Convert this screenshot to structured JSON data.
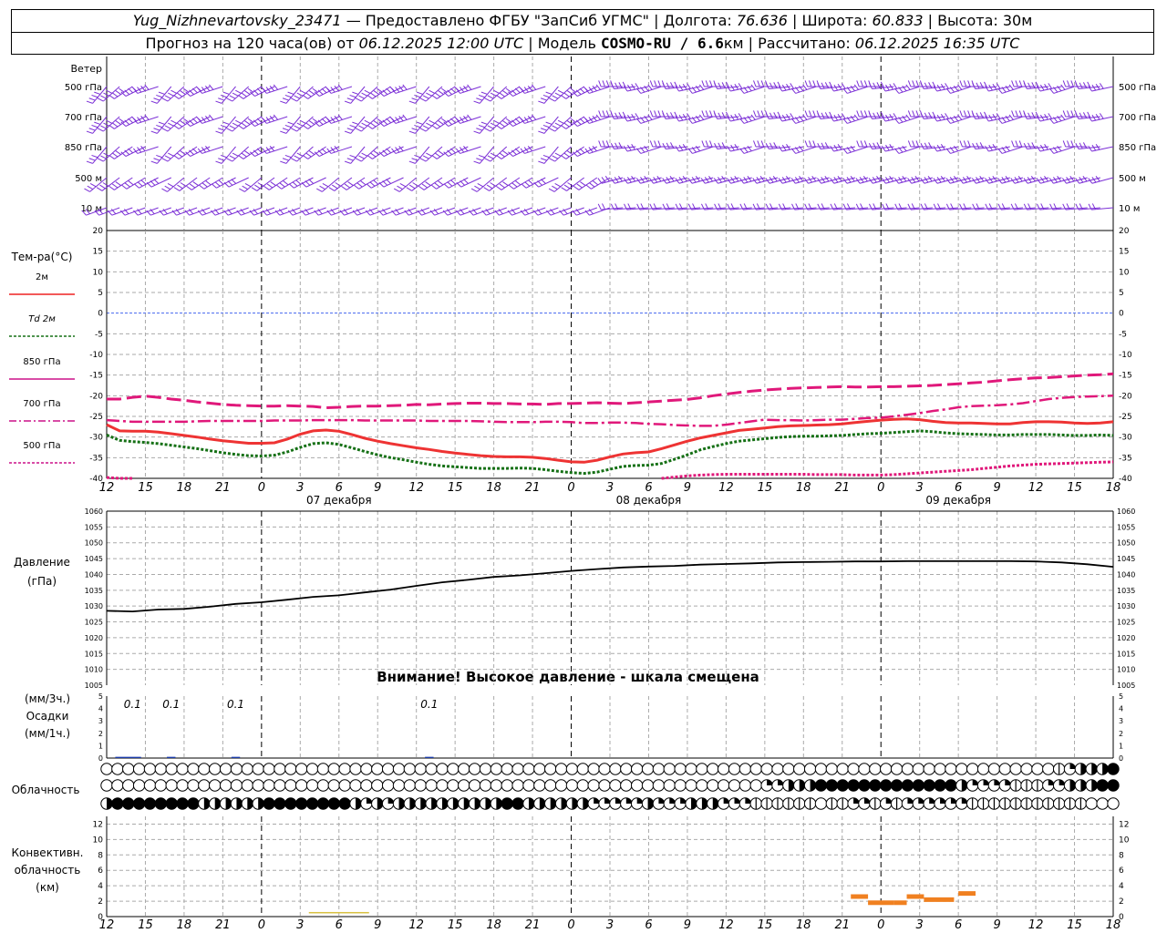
{
  "header": {
    "station": "Yug_Nizhnevartovsky_23471",
    "provider": "— Предоставлено ФГБУ \"ЗапСиб УГМС\" | Долгота:",
    "lon": "76.636",
    "lat_label": "| Широта:",
    "lat": "60.833",
    "alt_label": "| Высота: 30м",
    "forecast_label": "Прогноз на 120 часа(ов) от",
    "forecast_time": "06.12.2025 12:00 UTC",
    "model_label": "| Модель",
    "model": "COSMO-RU / 6.6",
    "model_unit": "км | Рассчитано:",
    "computed_time": "06.12.2025 16:35 UTC"
  },
  "wind_panel": {
    "title": "Ветер",
    "levels": [
      "500 гПа",
      "700 гПа",
      "850 гПа",
      "500 м",
      "10 м"
    ]
  },
  "temp_panel": {
    "title": "Тем-ра(°С)",
    "ylim": [
      -40,
      20
    ],
    "yticks": [
      20,
      15,
      10,
      5,
      0,
      -5,
      -10,
      -15,
      -20,
      -25,
      -30,
      -35,
      -40
    ],
    "legend": [
      {
        "label": "2м",
        "color": "#ee2222",
        "dash": ""
      },
      {
        "label": "Td 2м",
        "color": "#157015",
        "dash": "3,2"
      },
      {
        "label": "850 гПа",
        "color": "#cc1188",
        "dash": ""
      },
      {
        "label": "700 гПа",
        "color": "#cc1188",
        "dash": "8,3,2,3"
      },
      {
        "label": "500 гПа",
        "color": "#cc1188",
        "dash": "3,2"
      }
    ]
  },
  "x_axis": {
    "ticks": [
      "12",
      "15",
      "18",
      "21",
      "0",
      "3",
      "6",
      "9",
      "12",
      "15",
      "18",
      "21",
      "0",
      "3",
      "6",
      "9",
      "12",
      "15",
      "18",
      "21",
      "0",
      "3",
      "6",
      "9",
      "12",
      "15",
      "18"
    ],
    "dates": [
      "07 декабря",
      "08 декабря",
      "09 декабря"
    ]
  },
  "pressure_panel": {
    "title": "Давление",
    "unit": "(гПа)",
    "ylim": [
      1005,
      1060
    ],
    "yticks": [
      1060,
      1055,
      1050,
      1045,
      1040,
      1035,
      1030,
      1025,
      1020,
      1015,
      1010,
      1005
    ],
    "warning": "Внимание! Высокое давление - шкала смещена"
  },
  "precip_panel": {
    "unit_top": "(мм/3ч.)",
    "title": "Осадки",
    "unit_bottom": "(мм/1ч.)",
    "yticks": [
      5,
      4,
      3,
      2,
      1,
      0
    ],
    "labels": [
      {
        "hour": 6,
        "text": "0.1"
      },
      {
        "hour": 15,
        "text": "0.1"
      },
      {
        "hour": 30,
        "text": "0.1"
      },
      {
        "hour": 75,
        "text": "0.1"
      }
    ]
  },
  "cloud_panel": {
    "title": "Облачность"
  },
  "convective_panel": {
    "title_lines": [
      "Конвективн.",
      "облачность",
      "(км)"
    ],
    "yticks": [
      12,
      10,
      8,
      6,
      4,
      2,
      0
    ]
  },
  "colors": {
    "wind": "#7b2fd6",
    "grid": "#aaaaaa",
    "zero_line": "#4466ee",
    "pressure": "#000000",
    "precip": "#1a3aa8",
    "convective_orange": "#f08020",
    "convective_yellow": "#d8c040"
  },
  "chart_data": [
    {
      "type": "line",
      "title": "Тем-ра(°С)",
      "x_hours": [
        0,
        3,
        6,
        9,
        12,
        15,
        18,
        21,
        24,
        27,
        30,
        33,
        36,
        39,
        42,
        45,
        48,
        51,
        54,
        57,
        60,
        63,
        66,
        69,
        72,
        75,
        78,
        81,
        84,
        87,
        90,
        93,
        96,
        99,
        102,
        105,
        108,
        111,
        114,
        117,
        120,
        123,
        126,
        129,
        132,
        135,
        138,
        141,
        144,
        147,
        150,
        153,
        156,
        159,
        162,
        165,
        168,
        171,
        174,
        177,
        180,
        183,
        186,
        189,
        192,
        195,
        198,
        201,
        204,
        207,
        210,
        213,
        216,
        219,
        222,
        225,
        228,
        231,
        234
      ],
      "series": [
        {
          "name": "2м",
          "values": [
            -27,
            -28.5,
            -28.6,
            -28.6,
            -28.8,
            -29.2,
            -29.6,
            -30,
            -30.5,
            -30.9,
            -31.2,
            -31.5,
            -31.5,
            -31.4,
            -30.5,
            -29.3,
            -28.5,
            -28.3,
            -28.6,
            -29.4,
            -30.3,
            -31,
            -31.6,
            -32.1,
            -32.6,
            -33,
            -33.5,
            -33.9,
            -34.2,
            -34.5,
            -34.7,
            -34.8,
            -34.8,
            -34.9,
            -35.2,
            -35.6,
            -36,
            -36.1,
            -35.6,
            -34.8,
            -34.1,
            -33.8,
            -33.6,
            -32.8,
            -31.9,
            -31,
            -30.2,
            -29.6,
            -29,
            -28.4,
            -28.1,
            -27.8,
            -27.5,
            -27.3,
            -27.2,
            -27.1,
            -27,
            -26.8,
            -26.5,
            -26.2,
            -25.9,
            -25.7,
            -25.6,
            -25.8,
            -26.2,
            -26.5,
            -26.6,
            -26.6,
            -26.7,
            -26.8,
            -26.8,
            -26.5,
            -26.3,
            -26.3,
            -26.4,
            -26.6,
            -26.7,
            -26.6,
            -26.3
          ]
        },
        {
          "name": "Td 2м",
          "values": [
            -29.5,
            -30.8,
            -31.1,
            -31.3,
            -31.6,
            -32,
            -32.4,
            -32.8,
            -33.3,
            -33.8,
            -34.2,
            -34.5,
            -34.6,
            -34.4,
            -33.6,
            -32.5,
            -31.6,
            -31.4,
            -31.8,
            -32.6,
            -33.5,
            -34.3,
            -35,
            -35.5,
            -36.1,
            -36.6,
            -37,
            -37.2,
            -37.4,
            -37.6,
            -37.6,
            -37.6,
            -37.5,
            -37.6,
            -37.9,
            -38.3,
            -38.6,
            -38.8,
            -38.5,
            -37.8,
            -37.1,
            -36.9,
            -36.8,
            -36.4,
            -35.4,
            -34.3,
            -33.1,
            -32.3,
            -31.6,
            -31,
            -30.7,
            -30.4,
            -30.1,
            -29.9,
            -29.8,
            -29.8,
            -29.7,
            -29.6,
            -29.4,
            -29.2,
            -29.1,
            -28.9,
            -28.7,
            -28.5,
            -28.7,
            -29,
            -29.2,
            -29.3,
            -29.4,
            -29.5,
            -29.5,
            -29.4,
            -29.4,
            -29.4,
            -29.5,
            -29.6,
            -29.6,
            -29.5,
            -29.6
          ]
        },
        {
          "name": "850 гПа",
          "values": [
            -20.8,
            -20.8,
            -20.4,
            -20.1,
            -20.4,
            -20.8,
            -21.1,
            -21.5,
            -21.8,
            -22.1,
            -22.3,
            -22.4,
            -22.5,
            -22.5,
            -22.4,
            -22.5,
            -22.6,
            -22.9,
            -22.8,
            -22.6,
            -22.5,
            -22.5,
            -22.4,
            -22.3,
            -22.1,
            -22.2,
            -22,
            -21.9,
            -21.8,
            -21.8,
            -21.9,
            -21.9,
            -22,
            -22,
            -22.1,
            -21.9,
            -21.9,
            -21.8,
            -21.7,
            -21.8,
            -21.9,
            -21.7,
            -21.5,
            -21.3,
            -21.1,
            -20.9,
            -20.5,
            -20,
            -19.6,
            -19.2,
            -18.9,
            -18.6,
            -18.4,
            -18.2,
            -18.1,
            -18,
            -17.9,
            -17.8,
            -17.9,
            -17.9,
            -17.8,
            -17.8,
            -17.7,
            -17.6,
            -17.5,
            -17.3,
            -17.1,
            -16.9,
            -16.7,
            -16.4,
            -16.1,
            -15.9,
            -15.7,
            -15.6,
            -15.4,
            -15.2,
            -15,
            -14.9,
            -14.7
          ]
        },
        {
          "name": "700 гПа",
          "values": [
            -25.9,
            -26.1,
            -26.3,
            -26.3,
            -26.3,
            -26.3,
            -26.3,
            -26.2,
            -26.1,
            -26.1,
            -26.1,
            -26.1,
            -26.1,
            -26,
            -26,
            -26,
            -25.9,
            -25.9,
            -25.9,
            -25.9,
            -26,
            -26,
            -26,
            -26,
            -26,
            -26.1,
            -26.1,
            -26.1,
            -26.1,
            -26.2,
            -26.3,
            -26.4,
            -26.4,
            -26.4,
            -26.3,
            -26.3,
            -26.4,
            -26.6,
            -26.6,
            -26.5,
            -26.5,
            -26.6,
            -26.8,
            -26.9,
            -27.1,
            -27.2,
            -27.3,
            -27.3,
            -27,
            -26.6,
            -26.2,
            -25.8,
            -25.9,
            -25.9,
            -26,
            -25.9,
            -25.8,
            -25.8,
            -25.6,
            -25.4,
            -25.3,
            -25,
            -24.6,
            -24.2,
            -23.7,
            -23.3,
            -22.8,
            -22.5,
            -22.4,
            -22.3,
            -22.1,
            -21.8,
            -21.3,
            -20.8,
            -20.5,
            -20.3,
            -20.2,
            -20.1,
            -20
          ]
        },
        {
          "name": "500 гПа",
          "values": [
            -39.8,
            -40,
            -40,
            null,
            null,
            null,
            null,
            null,
            null,
            null,
            null,
            null,
            null,
            null,
            null,
            null,
            null,
            null,
            null,
            null,
            null,
            null,
            null,
            null,
            null,
            null,
            null,
            null,
            null,
            null,
            null,
            null,
            null,
            null,
            null,
            null,
            null,
            null,
            null,
            null,
            null,
            null,
            null,
            -40,
            -39.7,
            -39.4,
            -39.2,
            -39.1,
            -39,
            -39,
            -39,
            -39,
            -39,
            -39,
            -39,
            -39.1,
            -39.1,
            -39.1,
            -39.2,
            -39.2,
            -39.2,
            -39.1,
            -38.9,
            -38.7,
            -38.5,
            -38.3,
            -38.1,
            -37.9,
            -37.6,
            -37.3,
            -37,
            -36.8,
            -36.6,
            -36.5,
            -36.4,
            -36.3,
            -36.2,
            -36.1,
            -36
          ]
        }
      ],
      "ylim": [
        -40,
        20
      ]
    },
    {
      "type": "line",
      "title": "Давление",
      "x_hours": [
        0,
        6,
        12,
        18,
        24,
        30,
        36,
        42,
        48,
        54,
        60,
        66,
        72,
        78,
        84,
        90,
        96,
        102,
        108,
        114,
        120,
        126,
        132,
        138,
        144,
        150,
        156,
        162,
        168,
        174,
        180,
        186,
        192,
        198,
        204,
        210,
        216,
        222,
        228,
        234
      ],
      "series": [
        {
          "name": "Давление",
          "values": [
            1028.5,
            1028.3,
            1028.9,
            1029.1,
            1029.8,
            1030.7,
            1031.2,
            1032,
            1032.9,
            1033.4,
            1034.3,
            1035.2,
            1036.4,
            1037.5,
            1038.3,
            1039.2,
            1039.7,
            1040.4,
            1041.1,
            1041.7,
            1042.2,
            1042.5,
            1042.7,
            1043.1,
            1043.3,
            1043.5,
            1043.8,
            1043.9,
            1044,
            1044.1,
            1044.1,
            1044.2,
            1044.2,
            1044.2,
            1044.2,
            1044.2,
            1044.1,
            1043.8,
            1043.2,
            1042.4
          ]
        }
      ],
      "ylim": [
        1005,
        1060
      ]
    },
    {
      "type": "bar",
      "title": "Осадки",
      "bars": [
        {
          "x0": 2,
          "x1": 8,
          "value": 0.1
        },
        {
          "x0": 14,
          "x1": 16,
          "value": 0.1
        },
        {
          "x0": 29,
          "x1": 31,
          "value": 0.1
        },
        {
          "x0": 74,
          "x1": 76,
          "value": 0.1
        }
      ],
      "ylim": [
        0,
        5
      ]
    },
    {
      "type": "bar",
      "title": "Конвективн. облачность (км)",
      "bars": [
        {
          "x0": 47,
          "x1": 61,
          "value": 0.3,
          "color": "#d8c040"
        },
        {
          "x0": 173,
          "x1": 177,
          "value": 2.6,
          "color": "#f08020"
        },
        {
          "x0": 177,
          "x1": 183,
          "value": 1.8,
          "color": "#f08020"
        },
        {
          "x0": 183,
          "x1": 186,
          "value": 1.8,
          "color": "#f08020"
        },
        {
          "x0": 186,
          "x1": 190,
          "value": 2.6,
          "color": "#f08020"
        },
        {
          "x0": 190,
          "x1": 197,
          "value": 2.2,
          "color": "#f08020"
        },
        {
          "x0": 198,
          "x1": 202,
          "value": 3.0,
          "color": "#f08020"
        }
      ],
      "ylim": [
        0,
        13
      ]
    }
  ],
  "cloud_rows": [
    [
      0,
      0,
      0,
      0,
      0,
      0,
      0,
      0,
      0,
      0,
      0,
      0,
      0,
      0,
      0,
      0,
      0,
      0,
      0,
      0,
      0,
      0,
      0,
      0,
      0,
      0,
      0,
      0,
      0,
      0,
      0,
      0,
      0,
      0,
      0,
      0,
      0,
      0,
      0,
      0,
      0,
      0,
      0,
      0,
      0,
      0,
      0,
      0,
      0,
      0,
      0,
      0,
      0,
      0,
      0,
      0,
      0,
      0,
      0,
      0,
      0,
      0,
      0,
      0,
      0,
      0,
      0,
      0,
      0,
      0,
      0,
      0,
      0,
      0,
      0,
      0,
      0,
      0,
      0,
      0,
      0,
      0,
      0,
      0,
      0,
      0,
      0,
      0,
      1,
      2,
      3,
      3,
      3,
      4
    ],
    [
      0,
      0,
      0,
      0,
      0,
      0,
      0,
      0,
      0,
      0,
      0,
      0,
      0,
      0,
      0,
      0,
      0,
      0,
      0,
      0,
      0,
      0,
      0,
      0,
      0,
      0,
      0,
      0,
      0,
      0,
      0,
      0,
      0,
      0,
      0,
      0,
      0,
      0,
      0,
      0,
      0,
      0,
      0,
      0,
      0,
      0,
      0,
      0,
      0,
      0,
      0,
      0,
      0,
      0,
      0,
      0,
      0,
      0,
      0,
      0,
      0,
      2,
      2,
      3,
      3,
      3,
      4,
      4,
      4,
      4,
      4,
      4,
      4,
      4,
      4,
      4,
      4,
      4,
      4,
      3,
      2,
      2,
      2,
      2,
      1,
      1,
      1,
      2,
      2,
      3,
      3,
      3,
      4,
      4
    ],
    [
      3,
      4,
      4,
      4,
      4,
      4,
      4,
      4,
      4,
      3,
      3,
      3,
      3,
      3,
      3,
      4,
      4,
      4,
      4,
      4,
      4,
      4,
      4,
      3,
      2,
      3,
      2,
      3,
      3,
      3,
      3,
      3,
      3,
      3,
      3,
      3,
      3,
      4,
      4,
      3,
      3,
      3,
      3,
      3,
      3,
      2,
      2,
      2,
      2,
      2,
      3,
      2,
      2,
      2,
      3,
      3,
      3,
      2,
      2,
      2,
      1,
      1,
      1,
      1,
      1,
      1,
      0,
      1,
      1,
      2,
      2,
      1,
      2,
      1,
      2,
      2,
      2,
      2,
      2,
      2,
      1,
      1,
      1,
      1,
      1,
      1,
      1,
      1,
      1,
      1,
      1,
      0,
      0,
      0
    ]
  ]
}
